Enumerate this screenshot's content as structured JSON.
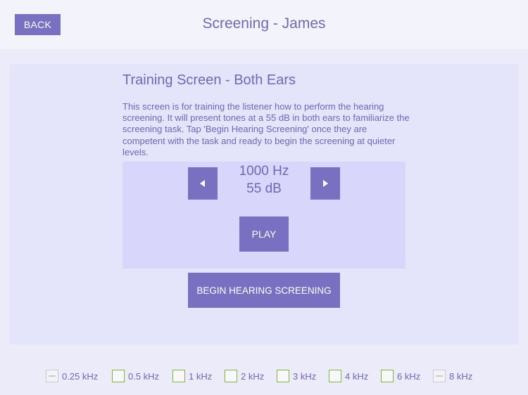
{
  "header": {
    "back_label": "BACK",
    "title": "Screening - James"
  },
  "training": {
    "heading": "Training Screen - Both Ears",
    "description": "This screen is for training the listener how to perform the hearing screening.  It will present tones at a 55 dB in both ears to familiarize the screening task.  Tap 'Begin Hearing Screening' once they are competent with the task and ready to begin the screening at quieter levels.",
    "frequency": "1000 Hz",
    "level": "55 dB",
    "play_label": "PLAY",
    "begin_label": "BEGIN HEARING SCREENING"
  },
  "frequencies": [
    {
      "label": "0.25 kHz",
      "state": "disabled"
    },
    {
      "label": "0.5 kHz",
      "state": "unchecked"
    },
    {
      "label": "1 kHz",
      "state": "unchecked"
    },
    {
      "label": "2 kHz",
      "state": "unchecked"
    },
    {
      "label": "3 kHz",
      "state": "unchecked"
    },
    {
      "label": "4 kHz",
      "state": "unchecked"
    },
    {
      "label": "6 kHz",
      "state": "unchecked"
    },
    {
      "label": "8 kHz",
      "state": "disabled"
    }
  ],
  "icons": {
    "prev": "triangle-left-icon",
    "next": "triangle-right-icon"
  },
  "colors": {
    "accent": "#7a70c2",
    "text": "#6f66b8",
    "checkbox_border": "#7fb832",
    "disabled": "#c9c9d2"
  }
}
